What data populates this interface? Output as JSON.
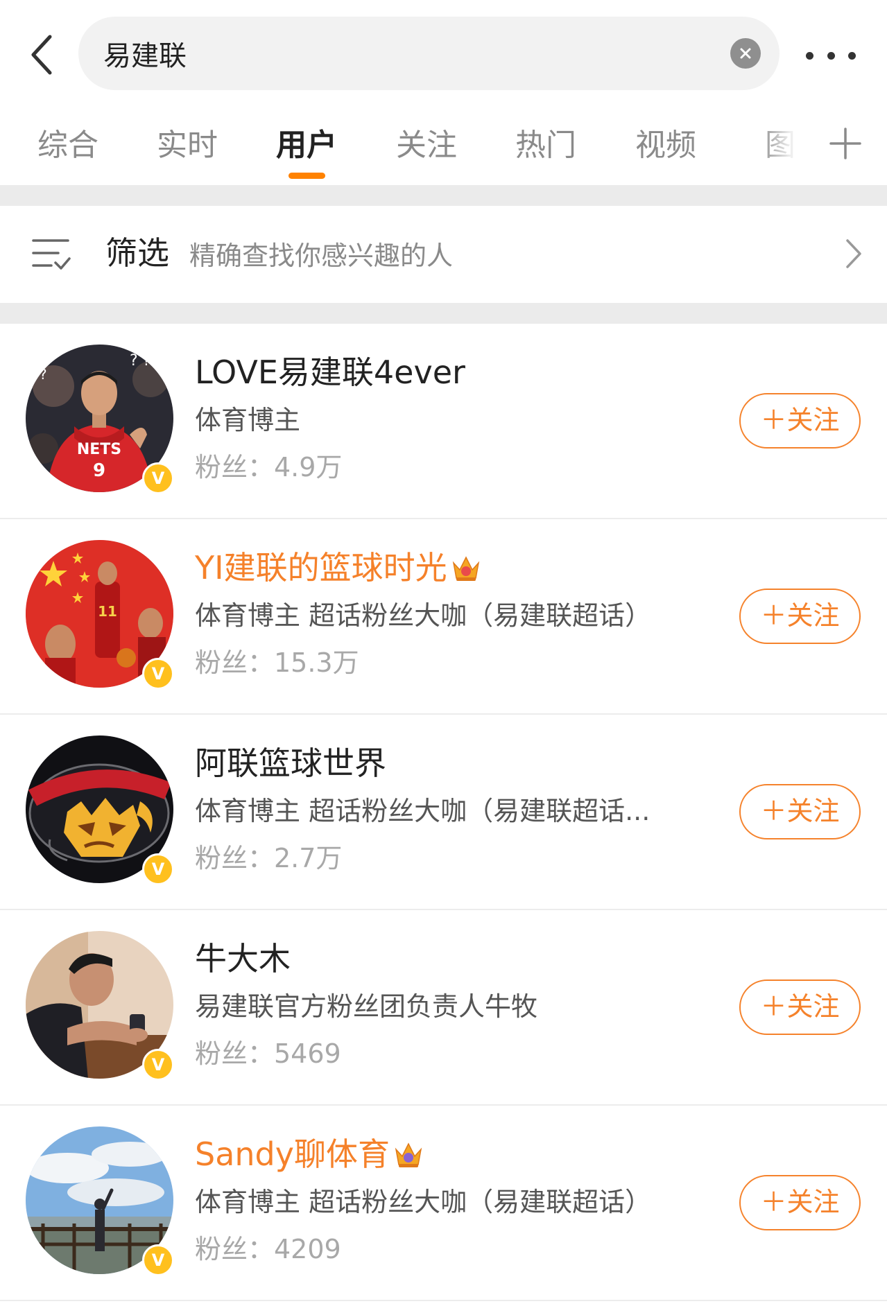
{
  "search": {
    "query": "易建联"
  },
  "tabs": [
    {
      "label": "综合",
      "active": false
    },
    {
      "label": "实时",
      "active": false
    },
    {
      "label": "用户",
      "active": true
    },
    {
      "label": "关注",
      "active": false
    },
    {
      "label": "热门",
      "active": false
    },
    {
      "label": "视频",
      "active": false
    },
    {
      "label": "图",
      "active": false
    }
  ],
  "filter": {
    "title": "筛选",
    "description": "精确查找你感兴趣的人"
  },
  "users": [
    {
      "name": "LOVE易建联4ever",
      "vip_name": false,
      "crown": false,
      "desc": "体育博主",
      "fans": "粉丝：4.9万",
      "follow": "＋关注",
      "verified": "V",
      "avatar": "nets-jersey-9"
    },
    {
      "name": "YI建联的篮球时光",
      "vip_name": true,
      "crown": true,
      "desc": "体育博主 超话粉丝大咖（易建联超话）",
      "fans": "粉丝：15.3万",
      "follow": "＋关注",
      "verified": "V",
      "avatar": "red-china-flag"
    },
    {
      "name": "阿联篮球世界",
      "vip_name": false,
      "crown": false,
      "desc": "体育博主 超话粉丝大咖（易建联超话...",
      "fans": "粉丝：2.7万",
      "follow": "＋关注",
      "verified": "V",
      "avatar": "guangdong-tiger-logo"
    },
    {
      "name": "牛大木",
      "vip_name": false,
      "crown": false,
      "desc": "易建联官方粉丝团负责人牛牧",
      "fans": "粉丝：5469",
      "follow": "＋关注",
      "verified": "V",
      "avatar": "man-with-phone"
    },
    {
      "name": "Sandy聊体育",
      "vip_name": true,
      "crown": true,
      "desc": "体育博主 超话粉丝大咖（易建联超话）",
      "fans": "粉丝：4209",
      "follow": "＋关注",
      "verified": "V",
      "avatar": "sky-landscape"
    }
  ],
  "colors": {
    "accent": "#ff8200",
    "vip_name": "#f5812a",
    "verified": "#ffc01e"
  }
}
